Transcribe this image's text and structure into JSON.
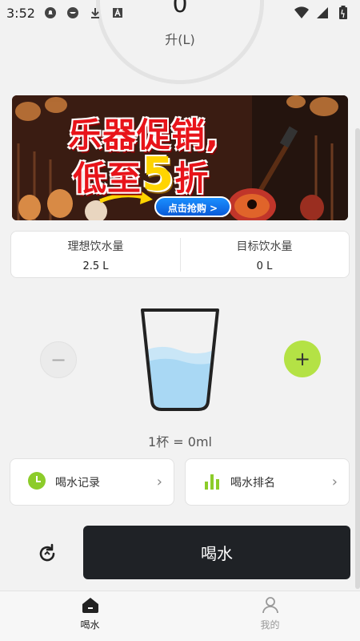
{
  "status_bar": {
    "time": "3:52",
    "icons_left": [
      "notification-bell-icon",
      "vpn-icon",
      "download-icon",
      "app-icon"
    ],
    "icons_right": [
      "wifi-icon",
      "signal-icon",
      "battery-icon"
    ]
  },
  "gauge": {
    "value": "0",
    "unit": "升(L)"
  },
  "banner": {
    "line1": "乐器促销,",
    "line2_prefix": "低至",
    "line2_number": "5",
    "line2_suffix": "折",
    "button": "点击抢购 >"
  },
  "amounts": {
    "ideal_label": "理想饮水量",
    "ideal_value": "2.5 L",
    "target_label": "目标饮水量",
    "target_value": "0 L"
  },
  "cup": {
    "info": "1杯 = 0ml",
    "minus": "−",
    "plus": "+",
    "accent": "#b4e245"
  },
  "nav_cards": {
    "records_label": "喝水记录",
    "ranking_label": "喝水排名",
    "chevron": "›"
  },
  "actions": {
    "drink_button": "喝水"
  },
  "tab_bar": {
    "tabs": [
      {
        "label": "喝水",
        "active": true
      },
      {
        "label": "我的",
        "active": false
      }
    ]
  }
}
